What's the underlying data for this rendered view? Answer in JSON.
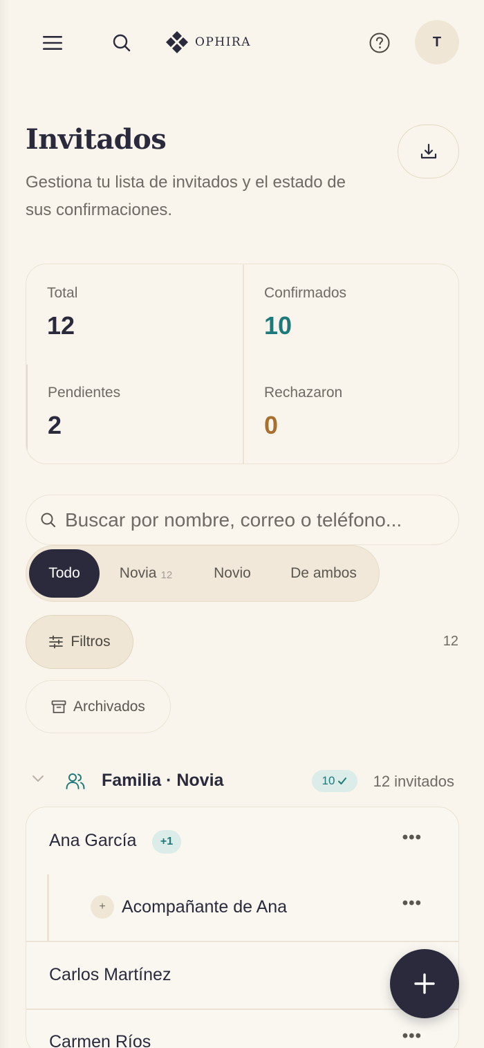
{
  "header": {
    "brand_name": "OPHIRA",
    "avatar_initial": "T"
  },
  "page": {
    "title": "Invitados",
    "subtitle": "Gestiona tu lista de invitados y el estado de sus confirmaciones."
  },
  "stats": {
    "total": {
      "label": "Total",
      "value": "12"
    },
    "confirmed": {
      "label": "Confirmados",
      "value": "10",
      "color": "#1e7a7a"
    },
    "pending": {
      "label": "Pendientes",
      "value": "2"
    },
    "rejected": {
      "label": "Rechazaron",
      "value": "0",
      "color": "#a8702e"
    }
  },
  "search": {
    "placeholder": "Buscar por nombre, correo o teléfono...",
    "value": ""
  },
  "segments": [
    {
      "label": "Todo",
      "count": "",
      "active": true
    },
    {
      "label": "Novia",
      "count": "12",
      "active": false
    },
    {
      "label": "Novio",
      "count": "",
      "active": false
    },
    {
      "label": "De ambos",
      "count": "",
      "active": false
    }
  ],
  "filters": {
    "filter_label": "Filtros",
    "result_count": "12",
    "archived_label": "Archivados"
  },
  "group": {
    "title": "Familia · Novia",
    "confirmed_badge": "10",
    "count_label": "12 invitados",
    "guests": [
      {
        "name": "Ana García",
        "badge": "+1"
      },
      {
        "name": "Acompañante de Ana",
        "companion": true
      },
      {
        "name": "Carlos Martínez"
      },
      {
        "name": "Carmen Ríos"
      }
    ]
  },
  "colors": {
    "background": "#f9f5ec",
    "primary": "#2b2a3d",
    "teal": "#1e7a7a",
    "brown": "#a8702e"
  },
  "icons": [
    "menu-icon",
    "search-icon",
    "brand-logo",
    "help-icon",
    "download-icon",
    "sliders-icon",
    "archive-icon",
    "chevron-down-icon",
    "users-icon",
    "check-icon",
    "more-icon",
    "plus-icon"
  ]
}
